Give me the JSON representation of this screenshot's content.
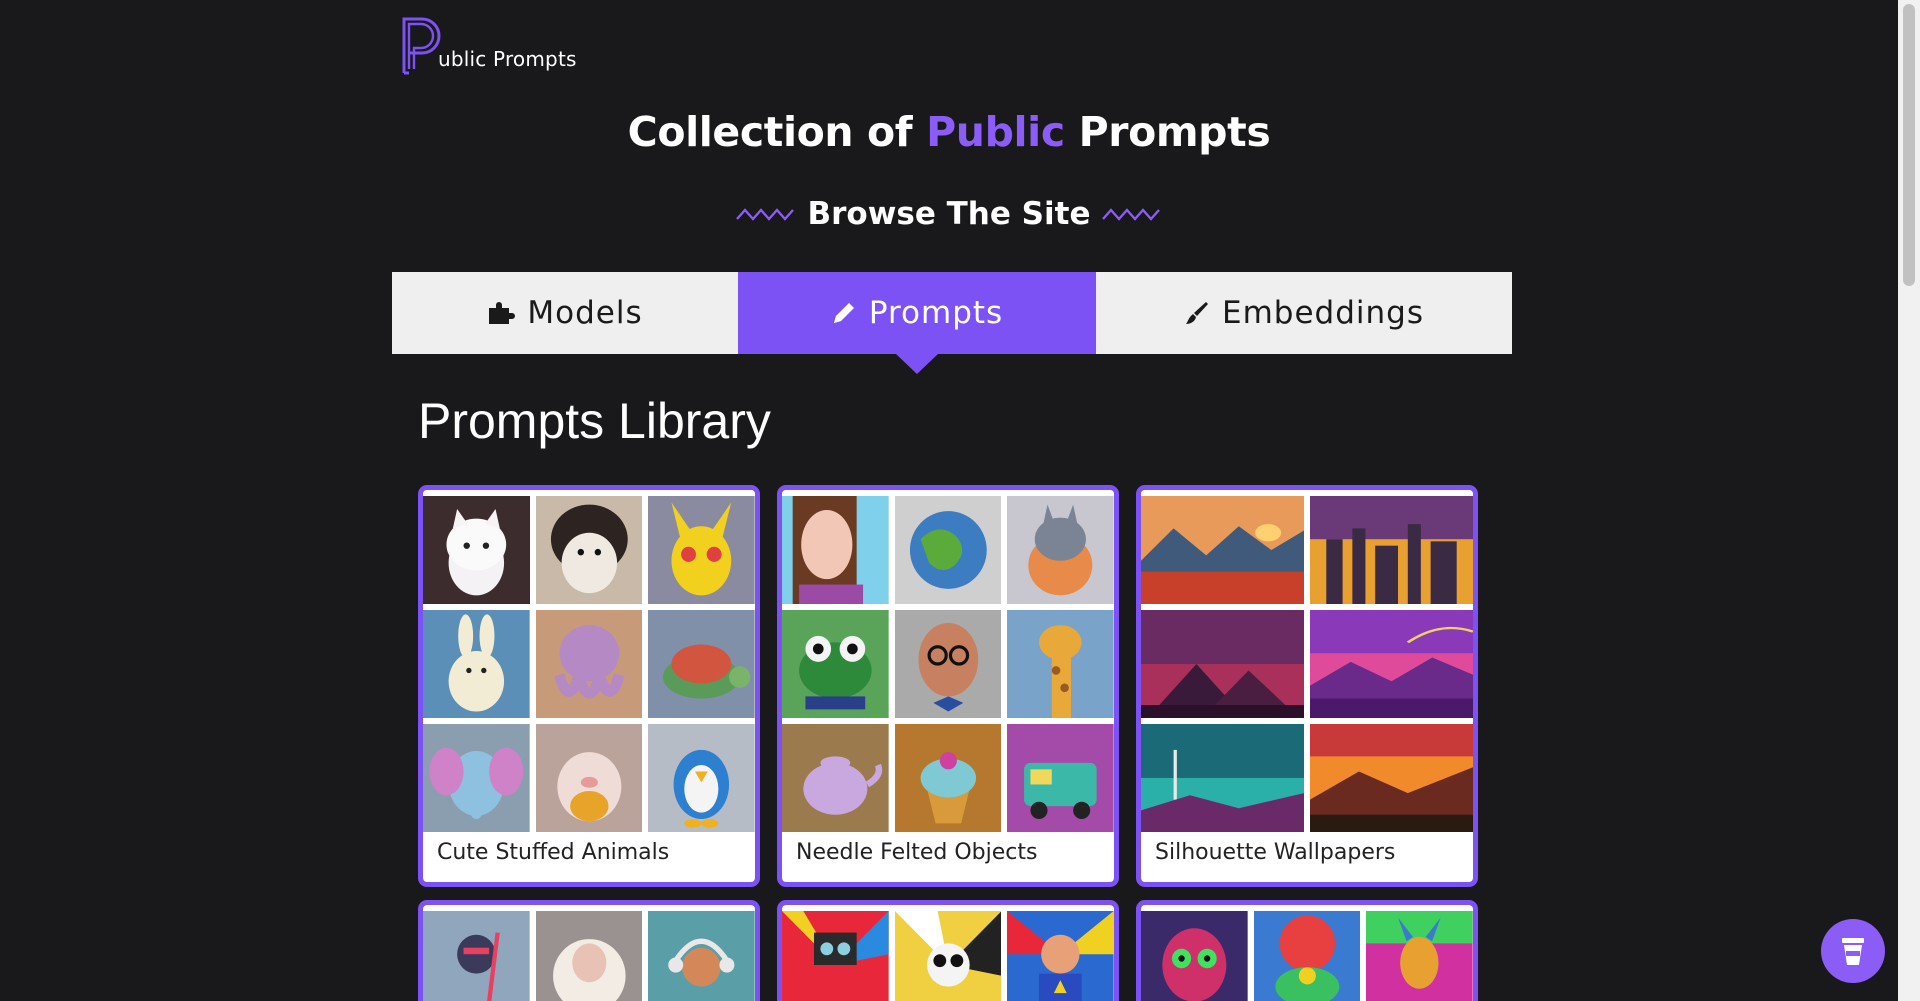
{
  "logo": {
    "text": "ublic Prompts"
  },
  "hero": {
    "prefix": "Collection of",
    "accent": "Public",
    "suffix": "Prompts"
  },
  "browse": {
    "label": "Browse The Site"
  },
  "tabs": [
    {
      "label": "Models",
      "icon": "puzzle-icon",
      "active": false
    },
    {
      "label": "Prompts",
      "icon": "pencil-icon",
      "active": true
    },
    {
      "label": "Embeddings",
      "icon": "brush-icon",
      "active": false
    }
  ],
  "library": {
    "title": "Prompts Library"
  },
  "cards": [
    {
      "caption": "Cute Stuffed Animals",
      "images": [
        "cat plush",
        "hedgehog plush",
        "pikachu plush",
        "bunny plush",
        "octopus plush",
        "turtle plush",
        "elephant plush",
        "pig plush",
        "penguin plush"
      ]
    },
    {
      "caption": "Needle Felted Objects",
      "images": [
        "girl",
        "globe",
        "totoro",
        "frog",
        "man with glasses",
        "giraffe",
        "teapot",
        "cupcake",
        "van"
      ]
    },
    {
      "caption": "Silhouette Wallpapers",
      "images": [
        "mountain sunset",
        "city skyline",
        "pyramids",
        "purple hills",
        "teal lake",
        "orange deer"
      ]
    },
    {
      "caption": "",
      "images": [
        "ninja",
        "sheep",
        "monkey"
      ]
    },
    {
      "caption": "",
      "images": [
        "pop art robot",
        "pop art panda",
        "pop art hero"
      ]
    },
    {
      "caption": "",
      "images": [
        "psychedelic skull",
        "psychedelic turtle",
        "psychedelic giraffe"
      ]
    }
  ],
  "colors": {
    "accent": "#7d52f4",
    "background": "#19181a",
    "tab_inactive": "#efefef"
  },
  "fab": {
    "icon": "coffee-cup-icon"
  }
}
